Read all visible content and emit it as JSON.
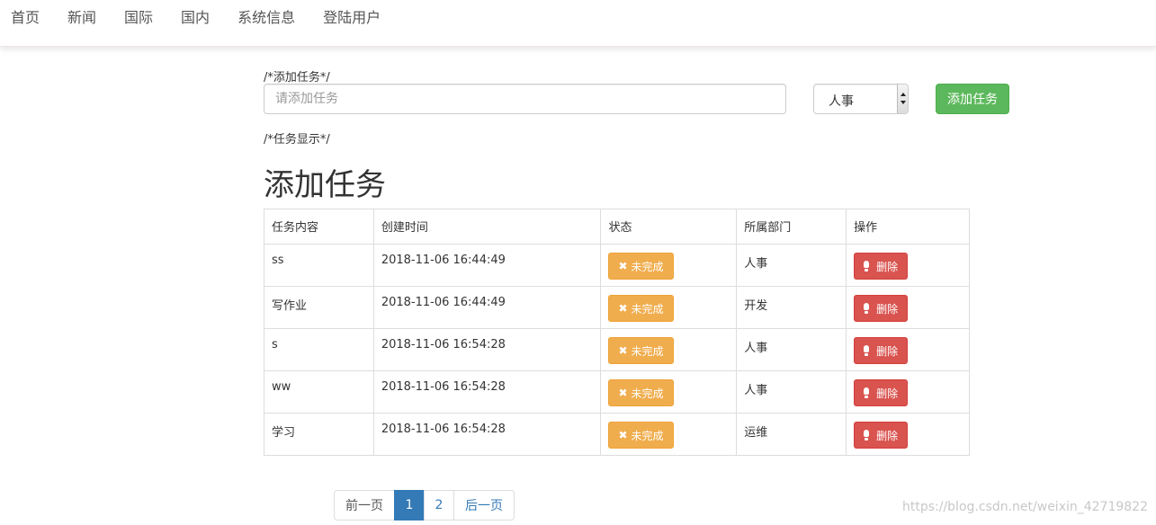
{
  "nav": {
    "items": [
      "首页",
      "新闻",
      "国际",
      "国内",
      "系统信息",
      "登陆用户"
    ]
  },
  "form": {
    "comment_add": "/*添加任务*/",
    "input_placeholder": "请添加任务",
    "input_value": "",
    "department_selected": "人事",
    "add_button_label": "添加任务",
    "comment_show": "/*任务显示*/"
  },
  "section_title": "添加任务",
  "table": {
    "headers": [
      "任务内容",
      "创建时间",
      "状态",
      "所属部门",
      "操作"
    ],
    "rows": [
      {
        "content": "ss",
        "created": "2018-11-06 16:44:49",
        "status": "未完成",
        "department": "人事",
        "action": "删除"
      },
      {
        "content": "写作业",
        "created": "2018-11-06 16:44:49",
        "status": "未完成",
        "department": "开发",
        "action": "删除"
      },
      {
        "content": "s",
        "created": "2018-11-06 16:54:28",
        "status": "未完成",
        "department": "人事",
        "action": "删除"
      },
      {
        "content": "ww",
        "created": "2018-11-06 16:54:28",
        "status": "未完成",
        "department": "人事",
        "action": "删除"
      },
      {
        "content": "学习",
        "created": "2018-11-06 16:54:28",
        "status": "未完成",
        "department": "运维",
        "action": "删除"
      }
    ]
  },
  "pagination": {
    "prev": "前一页",
    "pages": [
      "1",
      "2"
    ],
    "active_page": "1",
    "next": "后一页"
  },
  "watermark": "https://blog.csdn.net/weixin_42719822",
  "icons": {
    "status": "x-icon",
    "delete": "exclamation-icon"
  },
  "colors": {
    "primary": "#337ab7",
    "success": "#5cb85c",
    "warning": "#f0ad4e",
    "danger": "#d9534f"
  }
}
